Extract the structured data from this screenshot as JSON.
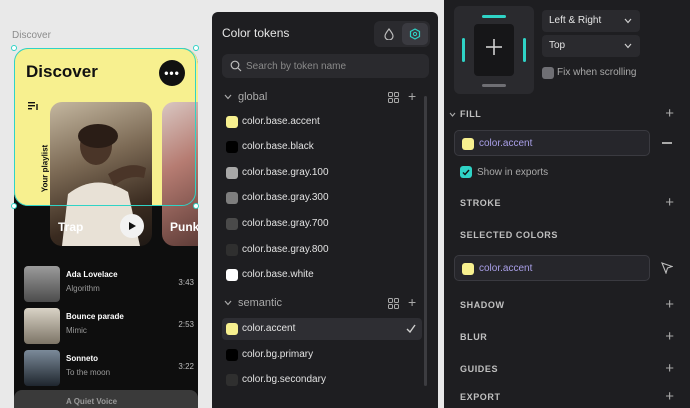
{
  "canvas": {
    "frame_label": "Discover",
    "hero": {
      "title": "Discover",
      "more_label": "•••",
      "playlist_label": "Your playlist"
    },
    "cards": [
      {
        "label": "Trap"
      },
      {
        "label": "Punk"
      }
    ],
    "tracks": [
      {
        "title": "Ada Lovelace",
        "artist": "Algorithm",
        "duration": "3:43"
      },
      {
        "title": "Bounce parade",
        "artist": "Mimic",
        "duration": "2:53"
      },
      {
        "title": "Sonneto",
        "artist": "To the moon",
        "duration": "3:22"
      },
      {
        "title": "A Quiet Voice",
        "artist": "",
        "duration": ""
      }
    ]
  },
  "tokens_panel": {
    "title": "Color tokens",
    "search_placeholder": "Search by token name",
    "groups": [
      {
        "name": "global",
        "tokens": [
          {
            "name": "color.base.accent",
            "color": "#f7f08f"
          },
          {
            "name": "color.base.black",
            "color": "#000000"
          },
          {
            "name": "color.base.gray.100",
            "color": "#a8a8a8"
          },
          {
            "name": "color.base.gray.300",
            "color": "#7e7e7e"
          },
          {
            "name": "color.base.gray.700",
            "color": "#4a4a4a"
          },
          {
            "name": "color.base.gray.800",
            "color": "#2f2f2f"
          },
          {
            "name": "color.base.white",
            "color": "#ffffff"
          }
        ]
      },
      {
        "name": "semantic",
        "tokens": [
          {
            "name": "color.accent",
            "color": "#f7f08f",
            "selected": true
          },
          {
            "name": "color.bg.primary",
            "color": "#000000"
          },
          {
            "name": "color.bg.secondary",
            "color": "#2f2f2f"
          }
        ]
      }
    ]
  },
  "properties": {
    "constraint_horizontal": "Left & Right",
    "constraint_vertical": "Top",
    "fix_when_scrolling_label": "Fix when scrolling",
    "fill": {
      "title": "FILL",
      "color_name": "color.accent",
      "color": "#f7f08f",
      "show_in_exports_label": "Show in exports"
    },
    "sections": {
      "stroke": "STROKE",
      "selected_colors": "SELECTED COLORS",
      "shadow": "SHADOW",
      "blur": "BLUR",
      "guides": "GUIDES",
      "export": "EXPORT"
    },
    "selected_color_name": "color.accent",
    "colors": {
      "accent_teal": "#2fd3c6",
      "token_text_purple": "#a99fe8"
    }
  }
}
